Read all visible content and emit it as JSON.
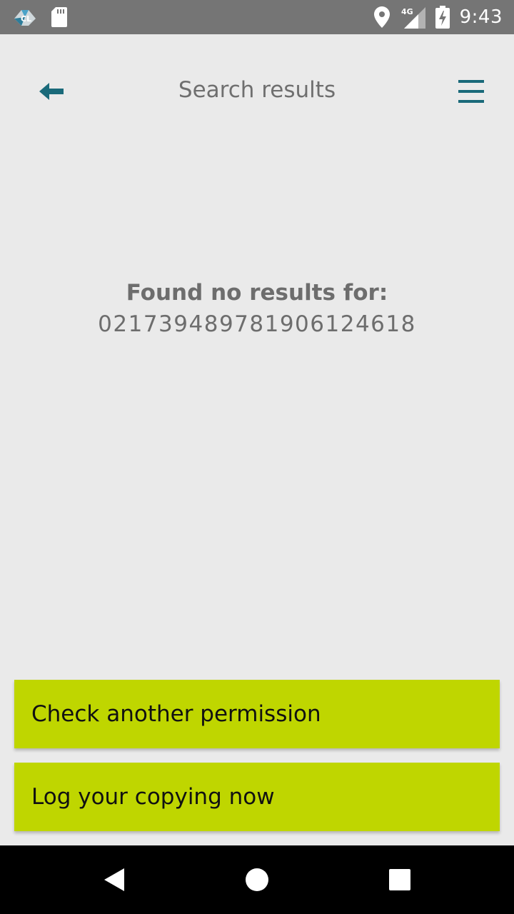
{
  "status_bar": {
    "time": "9:43",
    "network": "4G",
    "icons": [
      "app-logo-icon",
      "sd-card-icon",
      "location-icon",
      "signal-icon",
      "battery-charging-icon"
    ]
  },
  "header": {
    "title": "Search results",
    "back_icon": "back-arrow-icon",
    "menu_icon": "hamburger-menu-icon"
  },
  "message": {
    "heading": "Found no results for:",
    "query": "02173948978190612461​8"
  },
  "actions": {
    "check_label": "Check another permission",
    "log_label": "Log your copying now"
  },
  "nav_bar": {
    "icons": [
      "nav-back-icon",
      "nav-home-icon",
      "nav-recents-icon"
    ]
  },
  "colors": {
    "status_bar": "#757575",
    "background": "#eaeaea",
    "accent_teal": "#1a6a7a",
    "action_green": "#bfd600",
    "text_gray": "#6d6d6d"
  }
}
